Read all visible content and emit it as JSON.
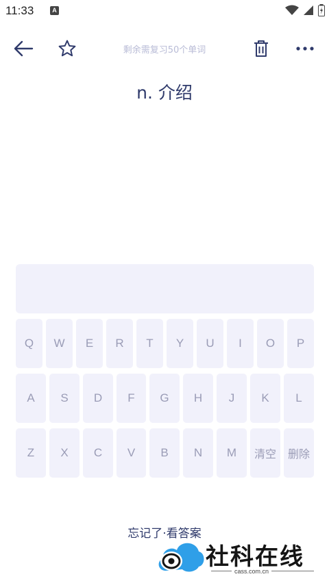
{
  "status": {
    "time": "11:33",
    "app_icon_letter": "A"
  },
  "toolbar": {
    "title": "剩余需复习50个单词",
    "icons": {
      "back": "back-arrow-icon",
      "star": "star-icon",
      "trash": "trash-icon",
      "more": "more-dots-icon"
    }
  },
  "word": {
    "definition": "n. 介绍"
  },
  "keyboard": {
    "row1": [
      "Q",
      "W",
      "E",
      "R",
      "T",
      "Y",
      "U",
      "I",
      "O",
      "P"
    ],
    "row2": [
      "A",
      "S",
      "D",
      "F",
      "G",
      "H",
      "J",
      "K",
      "L"
    ],
    "row3": [
      "Z",
      "X",
      "C",
      "V",
      "B",
      "N",
      "M",
      "清空",
      "删除"
    ]
  },
  "footer": {
    "forgot_label": "忘记了·看答案"
  },
  "watermark": {
    "brand": "社科在线",
    "url": "cass.com.cn"
  },
  "colors": {
    "accent": "#2f3a6b",
    "key_bg": "#f1f1fb",
    "key_text": "#9a9cb6",
    "logo_blue": "#2f9fe8"
  }
}
